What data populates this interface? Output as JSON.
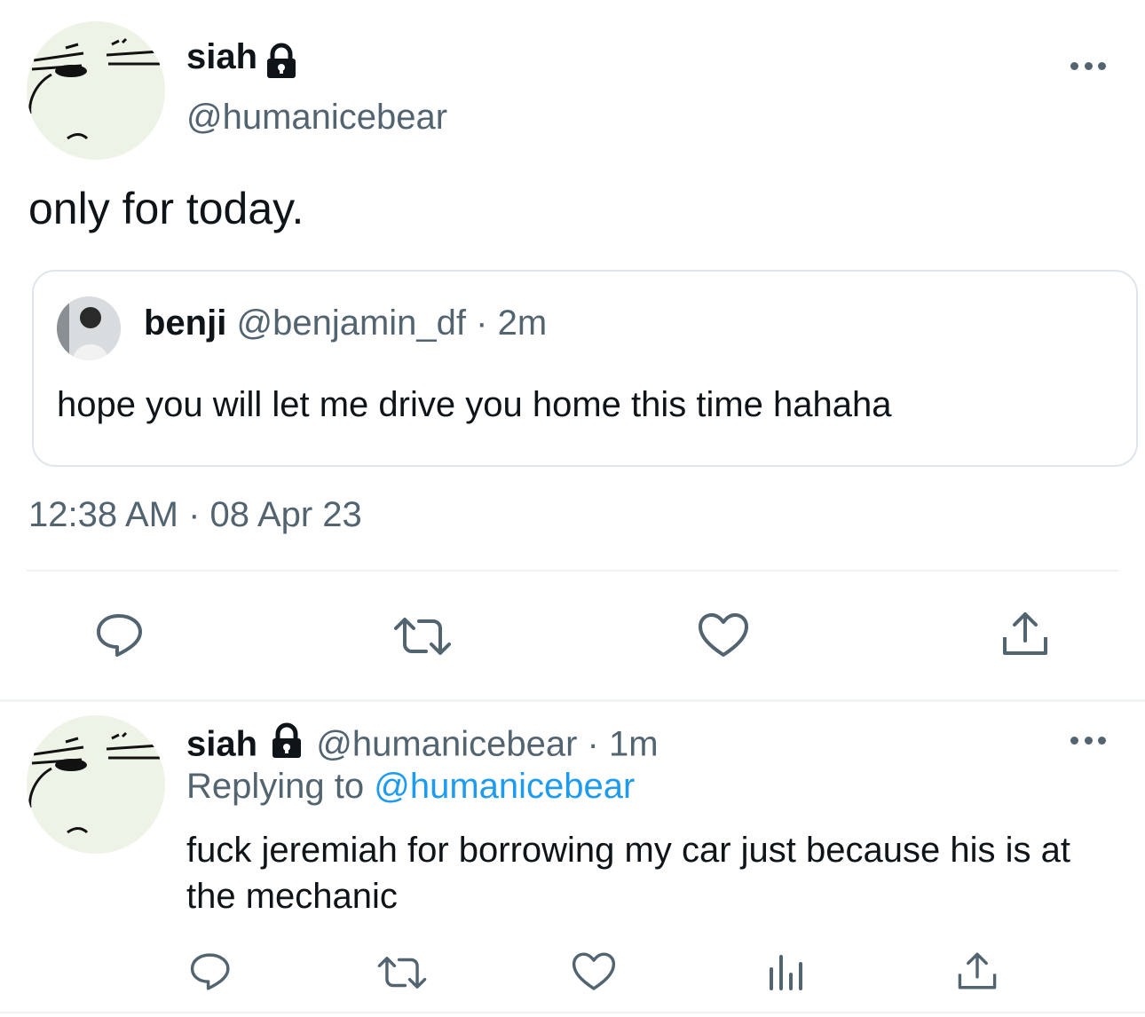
{
  "main_tweet": {
    "author_name": "siah",
    "author_handle": "@humanicebear",
    "text": "only for today.",
    "timestamp": "12:38 AM · 08 Apr 23",
    "quote": {
      "author_name": "benji",
      "author_handle": "@benjamin_df",
      "separator": "·",
      "time_ago": "2m",
      "text": "hope you will let me drive you home this time hahaha"
    },
    "actions": [
      "reply-icon",
      "retweet-icon",
      "like-icon",
      "share-icon"
    ]
  },
  "reply_tweet": {
    "author_name": "siah",
    "author_handle": "@humanicebear",
    "separator": "·",
    "time_ago": "1m",
    "replying_label": "Replying to",
    "replying_handle": "@humanicebear",
    "text": "fuck jeremiah for borrowing my car just because his is at the mechanic",
    "actions": [
      "reply-icon",
      "retweet-icon",
      "like-icon",
      "analytics-icon",
      "share-icon"
    ]
  },
  "colors": {
    "text_primary": "#0f1419",
    "text_secondary": "#536471",
    "link": "#1d9bf0",
    "border": "#dfe5ea",
    "avatar_bg": "#eef3e7"
  }
}
